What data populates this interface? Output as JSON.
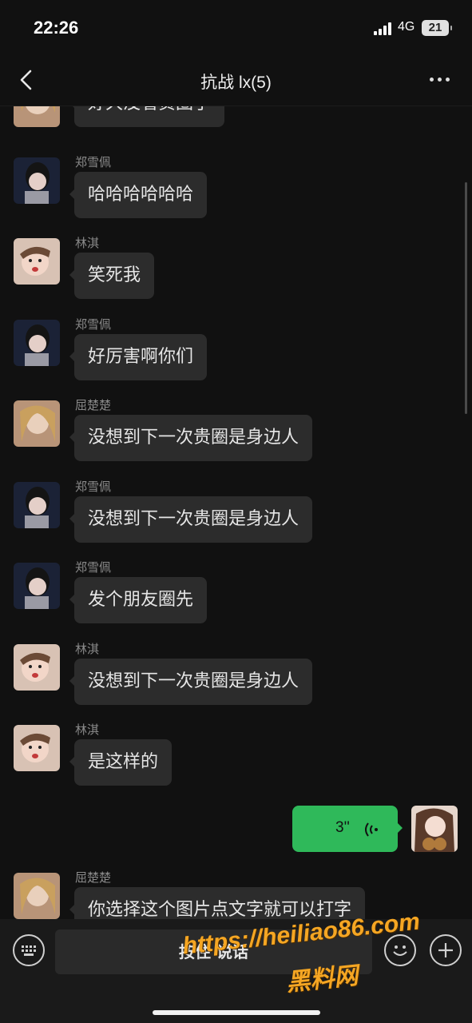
{
  "status_bar": {
    "time": "22:26",
    "network": "4G",
    "battery": "21"
  },
  "header": {
    "title": "抗战 lx(5)",
    "back_icon": "chevron-left-icon",
    "more_icon": "more-dots-icon"
  },
  "messages": [
    {
      "sender": "",
      "text": "好久没看贵圈了",
      "avatar": "avatar-quchuchu"
    },
    {
      "sender": "郑雪佩",
      "text": "哈哈哈哈哈哈",
      "avatar": "avatar-zhengxuepei"
    },
    {
      "sender": "林淇",
      "text": "笑死我",
      "avatar": "avatar-linqi"
    },
    {
      "sender": "郑雪佩",
      "text": "好厉害啊你们",
      "avatar": "avatar-zhengxuepei"
    },
    {
      "sender": "屈楚楚",
      "text": "没想到下一次贵圈是身边人",
      "avatar": "avatar-quchuchu"
    },
    {
      "sender": "郑雪佩",
      "text": "没想到下一次贵圈是身边人",
      "avatar": "avatar-zhengxuepei"
    },
    {
      "sender": "郑雪佩",
      "text": "发个朋友圈先",
      "avatar": "avatar-zhengxuepei"
    },
    {
      "sender": "林淇",
      "text": "没想到下一次贵圈是身边人",
      "avatar": "avatar-linqi"
    },
    {
      "sender": "林淇",
      "text": "是这样的",
      "avatar": "avatar-linqi"
    },
    {
      "sender": "屈楚楚",
      "text": "你选择这个图片点文字就可以打字",
      "avatar": "avatar-quchuchu"
    }
  ],
  "my_voice_message": {
    "duration": "3''",
    "icon": "voice-wave-icon"
  },
  "input_bar": {
    "keyboard_icon": "keyboard-icon",
    "hold_to_talk": "按住 说话",
    "emoji_icon": "emoji-icon",
    "plus_icon": "plus-icon"
  },
  "watermark": {
    "line1": "https://heiliao86.com",
    "line2": "黑料网"
  },
  "colors": {
    "background": "#111111",
    "bubble_other": "#2c2c2c",
    "bubble_me": "#2fb95a",
    "watermark": "#f5a623"
  }
}
